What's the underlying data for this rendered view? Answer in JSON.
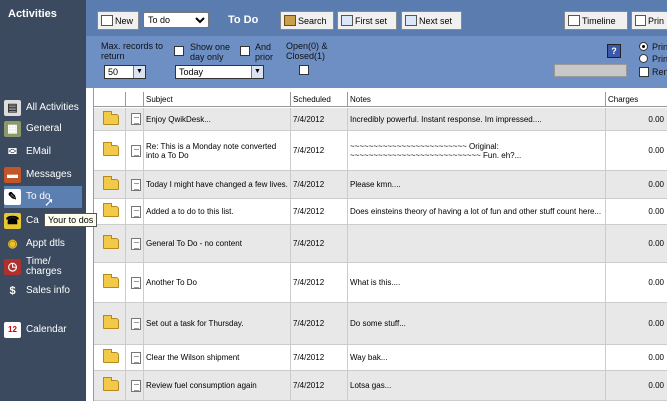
{
  "sidebar": {
    "title": "Activities",
    "items": [
      {
        "label": "All Activities",
        "icon": "all-activities-icon"
      },
      {
        "label": "General",
        "icon": "general-icon"
      },
      {
        "label": "EMail",
        "icon": "email-icon"
      },
      {
        "label": "Messages",
        "icon": "messages-icon"
      },
      {
        "label": "To do",
        "icon": "todo-icon"
      },
      {
        "label": "Ca",
        "icon": "calls-icon"
      },
      {
        "label": "Appt dtls",
        "icon": "appointment-icon"
      },
      {
        "label": "Time/ charges",
        "icon": "time-charges-icon"
      },
      {
        "label": "Sales info",
        "icon": "sales-icon"
      },
      {
        "label": "Calendar",
        "icon": "calendar-icon"
      }
    ],
    "tooltip": "Your to dos"
  },
  "toolbar": {
    "new_label": "New",
    "view_select": "To do",
    "title": "To Do",
    "search_label": "Search",
    "first_set_label": "First set",
    "next_set_label": "Next set",
    "timeline_label": "Timeline",
    "print_label": "Prin"
  },
  "filter": {
    "max_records_label": "Max. records to return",
    "max_records_value": "50",
    "show_one_day_label": "Show one day only",
    "day_value": "Today",
    "and_prior_label": "And prior",
    "open_closed_label": "Open(0) & Closed(1)",
    "radio1_label": "Prin",
    "radio2_label": "Prin",
    "check_label": "Ren"
  },
  "grid": {
    "columns": [
      "",
      "",
      "Subject",
      "Scheduled",
      "Notes",
      "Charges"
    ],
    "rows": [
      {
        "subject": "Enjoy QwikDesk...",
        "scheduled": "7/4/2012",
        "notes": "Incredibly powerful. Instant response. Im impressed....",
        "charges": "0.00"
      },
      {
        "subject": "Re: This is a Monday note converted into a To Do",
        "scheduled": "7/4/2012",
        "notes": "~~~~~~~~~~~~~~~~~~~~~~~~~ Original: ~~~~~~~~~~~~~~~~~~~~~~~~~~~~ Fun. eh?...",
        "charges": "0.00"
      },
      {
        "subject": "Today I might have changed a few lives.",
        "scheduled": "7/4/2012",
        "notes": "Please kmn....",
        "charges": "0.00"
      },
      {
        "subject": "Added a to do to this list.",
        "scheduled": "7/4/2012",
        "notes": "Does einsteins theory of having a lot of fun and other stuff count here...",
        "charges": "0.00"
      },
      {
        "subject": "General To Do - no content",
        "scheduled": "7/4/2012",
        "notes": "",
        "charges": "0.00"
      },
      {
        "subject": "Another To Do",
        "scheduled": "7/4/2012",
        "notes": "What is this....",
        "charges": "0.00"
      },
      {
        "subject": "Set out a task for Thursday.",
        "scheduled": "7/4/2012",
        "notes": "Do some stuff...",
        "charges": "0.00"
      },
      {
        "subject": "Clear the Wilson shipment",
        "scheduled": "7/4/2012",
        "notes": "Way bak...",
        "charges": "0.00"
      },
      {
        "subject": "Review fuel consumption again",
        "scheduled": "7/4/2012",
        "notes": "Lotsa gas...",
        "charges": "0.00"
      }
    ]
  }
}
